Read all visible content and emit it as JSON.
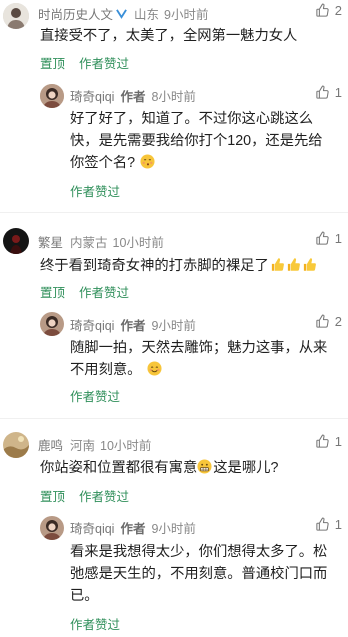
{
  "comments": [
    {
      "user": "时尚历史人文",
      "location": "山东",
      "time": "9小时前",
      "likes": "2",
      "text": "直接受不了，太美了，全网第一魅力女人",
      "actions": [
        "置顶",
        "作者赞过"
      ],
      "reply": {
        "user": "琦奇qiqi",
        "tag": "作者",
        "time": "8小时前",
        "likes": "1",
        "text_lines": [
          "好了好了，知道了。不过你这心跳这么",
          "快，是先需要我给你打个120，还是先给",
          "你签个名?"
        ],
        "actions": [
          "作者赞过"
        ]
      }
    },
    {
      "user": "繁星",
      "location": "内蒙古",
      "time": "10小时前",
      "likes": "1",
      "text": "终于看到琦奇女神的打赤脚的裸足了",
      "actions": [
        "置顶",
        "作者赞过"
      ],
      "reply": {
        "user": "琦奇qiqi",
        "tag": "作者",
        "time": "9小时前",
        "likes": "2",
        "text_lines": [
          "随脚一拍，天然去雕饰；魅力这事，从来",
          "不用刻意。"
        ],
        "actions": [
          "作者赞过"
        ]
      }
    },
    {
      "user": "鹿鸣",
      "location": "河南",
      "time": "10小时前",
      "likes": "1",
      "text_a": "你站姿和位置都很有寓意",
      "text_b": "这是哪儿?",
      "actions": [
        "置顶",
        "作者赞过"
      ],
      "reply": {
        "user": "琦奇qiqi",
        "tag": "作者",
        "time": "9小时前",
        "likes": "1",
        "text_lines": [
          "看来是我想得太少，你们想得太多了。松",
          "弛感是天生的，不用刻意。普通校门口而",
          "已。"
        ],
        "actions": [
          "作者赞过"
        ]
      }
    }
  ],
  "colors": {
    "action_green": "#2f8f5a",
    "meta_gray": "#888888",
    "text": "#1f1f1f",
    "verified_blue": "#3a8fd8"
  },
  "icons": {
    "like": "thumb-up-outline-icon",
    "verified": "verified-badge-icon",
    "emoji_kiss": "kissing-face-emoji",
    "emoji_smile": "smiling-face-emoji",
    "emoji_grin": "grimacing-face-emoji",
    "emoji_thumbs": "thumbs-up-emoji"
  }
}
